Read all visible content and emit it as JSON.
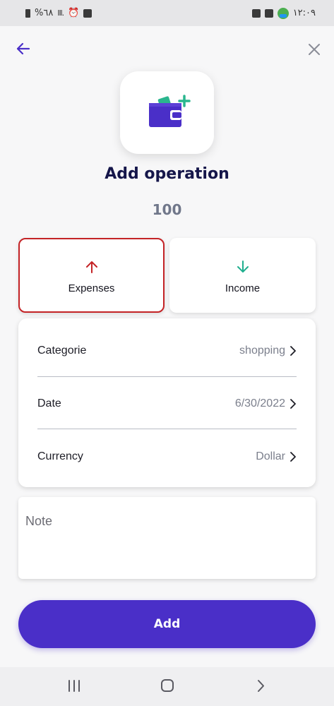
{
  "status_bar": {
    "battery_text": "%٦٨",
    "time": "١٢:٠٩"
  },
  "header": {
    "title": "Add operation",
    "amount": "100"
  },
  "types": {
    "expenses_label": "Expenses",
    "income_label": "Income",
    "selected": "Expenses"
  },
  "details": {
    "rows": [
      {
        "label": "Categorie",
        "value": "shopping"
      },
      {
        "label": "Date",
        "value": "6/30/2022"
      },
      {
        "label": "Currency",
        "value": "Dollar"
      }
    ]
  },
  "note": {
    "placeholder": "Note"
  },
  "actions": {
    "add_label": "Add"
  },
  "colors": {
    "primary": "#4a2fc8",
    "title": "#15164a",
    "expense_red": "#c42326",
    "income_green": "#1fae8e",
    "wallet_accent": "#2ab68e"
  }
}
